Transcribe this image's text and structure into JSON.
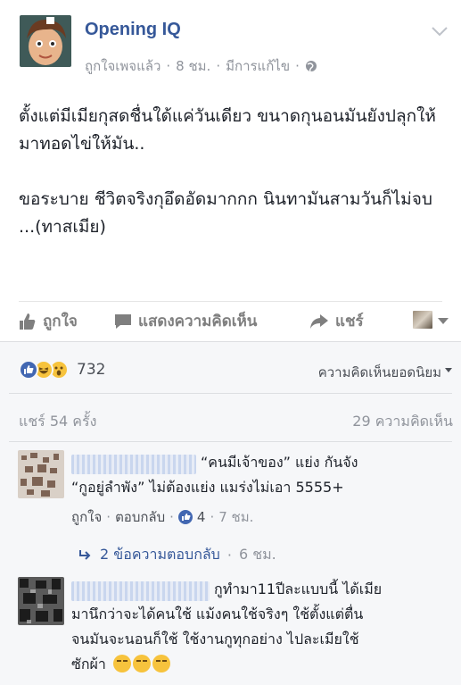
{
  "post": {
    "page_name": "Opening IQ",
    "meta": {
      "feeling": "ถูกใจเพจแล้ว",
      "time": "8 ชม.",
      "edited": "มีการแก้ไข",
      "dot": "·"
    },
    "paragraphs": [
      "ตั้งแต่มีเมียกุสดชื่นใด้แค่วันเดียว ขนาดกุนอนมันยังปลุกให้มาทอดไข่ให้มัน..",
      "ขอระบาย ชีวิตจริงกุอึดอัดมากกก นินทามันสามวันก็ไม่จบ ...(ทาสเมีย)"
    ],
    "icons": {
      "menu": "chevron-down-icon",
      "privacy": "globe-icon"
    }
  },
  "actions": {
    "like_label": "ถูกใจ",
    "comment_label": "แสดงความคิดเห็น",
    "share_label": "แชร์"
  },
  "reactions": {
    "types": [
      "like",
      "haha",
      "wow"
    ],
    "count": "732",
    "sort_label": "ความคิดเห็นยอดนิยม"
  },
  "stats": {
    "shares": "แชร์ 54 ครั้ง",
    "comments": "29 ความคิดเห็น"
  },
  "comments": [
    {
      "text_lines": [
        "“คนมีเจ้าของ” แย่ง กันจัง",
        "“กูอยู่ลำพัง” ไม่ต้องแย่ง แมร่งไม่เอา 5555+"
      ],
      "like_label": "ถูกใจ",
      "reply_label": "ตอบกลับ",
      "like_count": "4",
      "time": "7 ชม.",
      "replies_label": "2 ข้อความตอบกลับ",
      "replies_time": "6 ชม."
    },
    {
      "text_lines": [
        "กูทำมา11ปีละแบบนี้ ได้เมีย",
        "มานึกว่าจะได้คนใช้ แม้งคนใช้จริงๆ ใช้ตั้งแต่ตื่น",
        "จนมันจะนอนก็ใช้ ใช้งานกูทุกอย่าง ไปละเมียใช้",
        "ซักผ้า"
      ],
      "emoji_name": "persevering-face-emoji"
    }
  ],
  "colors": {
    "link": "#365899",
    "muted": "#90949c",
    "action": "#7f7f7f",
    "like_blue": "#4267b2",
    "emoji_yellow": "#f7c33d",
    "comments_bg": "#f6f7f9"
  }
}
